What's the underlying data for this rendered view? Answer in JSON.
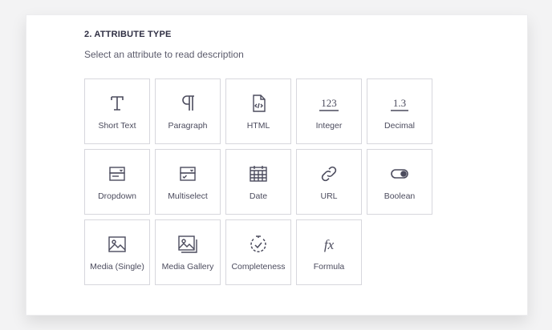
{
  "section": {
    "title": "2. ATTRIBUTE TYPE",
    "subtitle": "Select an attribute to read description"
  },
  "attribute_types": [
    {
      "label": "Short Text",
      "icon": "text-icon"
    },
    {
      "label": "Paragraph",
      "icon": "pilcrow-icon"
    },
    {
      "label": "HTML",
      "icon": "html-file-icon"
    },
    {
      "label": "Integer",
      "icon": "number-123-icon"
    },
    {
      "label": "Decimal",
      "icon": "decimal-icon"
    },
    {
      "label": "Dropdown",
      "icon": "dropdown-icon"
    },
    {
      "label": "Multiselect",
      "icon": "multiselect-icon"
    },
    {
      "label": "Date",
      "icon": "calendar-icon"
    },
    {
      "label": "URL",
      "icon": "link-icon"
    },
    {
      "label": "Boolean",
      "icon": "toggle-icon"
    },
    {
      "label": "Media (Single)",
      "icon": "image-icon"
    },
    {
      "label": "Media Gallery",
      "icon": "gallery-icon"
    },
    {
      "label": "Completeness",
      "icon": "completeness-icon"
    },
    {
      "label": "Formula",
      "icon": "formula-icon"
    }
  ],
  "icon_glyphs": {
    "integer": "123",
    "decimal": "1.3",
    "formula": "fx"
  },
  "colors": {
    "icon": "#4b4b5d",
    "border": "#d7d7dd",
    "heading": "#2f2f43"
  }
}
